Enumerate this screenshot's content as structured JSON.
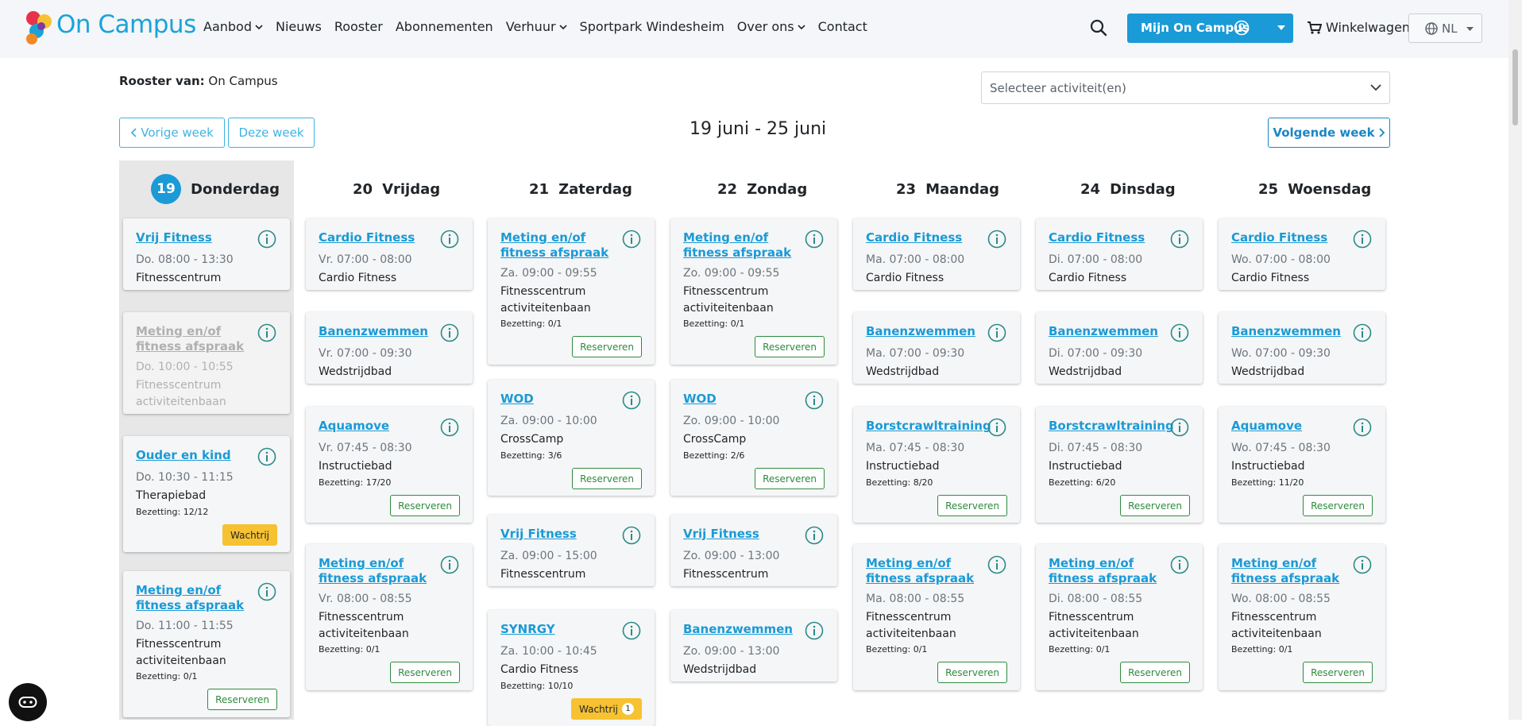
{
  "header": {
    "logo_text": "On Campus",
    "nav": [
      {
        "label": "Aanbod",
        "dropdown": true
      },
      {
        "label": "Nieuws",
        "dropdown": false
      },
      {
        "label": "Rooster",
        "dropdown": false
      },
      {
        "label": "Abonnementen",
        "dropdown": false
      },
      {
        "label": "Verhuur",
        "dropdown": true
      },
      {
        "label": "Sportpark Windesheim",
        "dropdown": false
      },
      {
        "label": "Over ons",
        "dropdown": true
      },
      {
        "label": "Contact",
        "dropdown": false
      }
    ],
    "account_button": "Mijn On Campus",
    "cart_label": "Winkelwagen",
    "language": "NL",
    "icons": [
      "search-icon",
      "user-circle-icon",
      "cart-icon",
      "globe-icon",
      "chat-icon"
    ],
    "accent_color": "#1a9ad6"
  },
  "schedule": {
    "rooster_prefix": "Rooster van:",
    "rooster_name": "On Campus",
    "activity_placeholder": "Selecteer activiteit(en)",
    "prev_week": "Vorige week",
    "this_week": "Deze week",
    "next_week": "Volgende week",
    "week_title": "19 juni - 25 juni"
  },
  "days": [
    {
      "num": "19",
      "name": "Donderdag",
      "today": true,
      "cards": [
        {
          "title": "Vrij Fitness",
          "time": "Do. 08:00 - 13:30",
          "location": "Fitnesscentrum"
        },
        {
          "title": "Meting en/of fitness afspraak",
          "time": "Do. 10:00 - 10:55",
          "location": "Fitnesscentrum activiteitenbaan",
          "faded": true
        },
        {
          "title": "Ouder en kind",
          "time": "Do. 10:30 - 11:15",
          "location": "Therapiebad",
          "occupancy": "Bezetting: 12/12",
          "button": "Wachtrij"
        },
        {
          "title": "Meting en/of fitness afspraak",
          "time": "Do. 11:00 - 11:55",
          "location": "Fitnesscentrum activiteitenbaan",
          "occupancy": "Bezetting: 0/1",
          "button": "Reserveren"
        }
      ]
    },
    {
      "num": "20",
      "name": "Vrijdag",
      "cards": [
        {
          "title": "Cardio Fitness",
          "time": "Vr. 07:00 - 08:00",
          "location": "Cardio Fitness"
        },
        {
          "title": "Banenzwemmen",
          "time": "Vr. 07:00 - 09:30",
          "location": "Wedstrijdbad"
        },
        {
          "title": "Aquamove",
          "time": "Vr. 07:45 - 08:30",
          "location": "Instructiebad",
          "occupancy": "Bezetting: 17/20",
          "button": "Reserveren"
        },
        {
          "title": "Meting en/of fitness afspraak",
          "time": "Vr. 08:00 - 08:55",
          "location": "Fitnesscentrum activiteitenbaan",
          "occupancy": "Bezetting: 0/1",
          "button": "Reserveren"
        }
      ]
    },
    {
      "num": "21",
      "name": "Zaterdag",
      "cards": [
        {
          "title": "Meting en/of fitness afspraak",
          "time": "Za. 09:00 - 09:55",
          "location": "Fitnesscentrum activiteitenbaan",
          "occupancy": "Bezetting: 0/1",
          "button": "Reserveren"
        },
        {
          "title": "WOD",
          "time": "Za. 09:00 - 10:00",
          "location": "CrossCamp",
          "occupancy": "Bezetting: 3/6",
          "button": "Reserveren"
        },
        {
          "title": "Vrij Fitness",
          "time": "Za. 09:00 - 15:00",
          "location": "Fitnesscentrum"
        },
        {
          "title": "SYNRGY",
          "time": "Za. 10:00 - 10:45",
          "location": "Cardio Fitness",
          "occupancy": "Bezetting: 10/10",
          "button": "Wachtrij",
          "badge": "1"
        }
      ]
    },
    {
      "num": "22",
      "name": "Zondag",
      "cards": [
        {
          "title": "Meting en/of fitness afspraak",
          "time": "Zo. 09:00 - 09:55",
          "location": "Fitnesscentrum activiteitenbaan",
          "occupancy": "Bezetting: 0/1",
          "button": "Reserveren"
        },
        {
          "title": "WOD",
          "time": "Zo. 09:00 - 10:00",
          "location": "CrossCamp",
          "occupancy": "Bezetting: 2/6",
          "button": "Reserveren"
        },
        {
          "title": "Vrij Fitness",
          "time": "Zo. 09:00 - 13:00",
          "location": "Fitnesscentrum"
        },
        {
          "title": "Banenzwemmen",
          "time": "Zo. 09:00 - 13:00",
          "location": "Wedstrijdbad"
        }
      ]
    },
    {
      "num": "23",
      "name": "Maandag",
      "cards": [
        {
          "title": "Cardio Fitness",
          "time": "Ma. 07:00 - 08:00",
          "location": "Cardio Fitness"
        },
        {
          "title": "Banenzwemmen",
          "time": "Ma. 07:00 - 09:30",
          "location": "Wedstrijdbad"
        },
        {
          "title": "Borstcrawltraining",
          "time": "Ma. 07:45 - 08:30",
          "location": "Instructiebad",
          "occupancy": "Bezetting: 8/20",
          "button": "Reserveren"
        },
        {
          "title": "Meting en/of fitness afspraak",
          "time": "Ma. 08:00 - 08:55",
          "location": "Fitnesscentrum activiteitenbaan",
          "occupancy": "Bezetting: 0/1",
          "button": "Reserveren"
        }
      ]
    },
    {
      "num": "24",
      "name": "Dinsdag",
      "cards": [
        {
          "title": "Cardio Fitness",
          "time": "Di. 07:00 - 08:00",
          "location": "Cardio Fitness"
        },
        {
          "title": "Banenzwemmen",
          "time": "Di. 07:00 - 09:30",
          "location": "Wedstrijdbad"
        },
        {
          "title": "Borstcrawltraining",
          "time": "Di. 07:45 - 08:30",
          "location": "Instructiebad",
          "occupancy": "Bezetting: 6/20",
          "button": "Reserveren"
        },
        {
          "title": "Meting en/of fitness afspraak",
          "time": "Di. 08:00 - 08:55",
          "location": "Fitnesscentrum activiteitenbaan",
          "occupancy": "Bezetting: 0/1",
          "button": "Reserveren"
        }
      ]
    },
    {
      "num": "25",
      "name": "Woensdag",
      "cards": [
        {
          "title": "Cardio Fitness",
          "time": "Wo. 07:00 - 08:00",
          "location": "Cardio Fitness"
        },
        {
          "title": "Banenzwemmen",
          "time": "Wo. 07:00 - 09:30",
          "location": "Wedstrijdbad"
        },
        {
          "title": "Aquamove",
          "time": "Wo. 07:45 - 08:30",
          "location": "Instructiebad",
          "occupancy": "Bezetting: 11/20",
          "button": "Reserveren"
        },
        {
          "title": "Meting en/of fitness afspraak",
          "time": "Wo. 08:00 - 08:55",
          "location": "Fitnesscentrum activiteitenbaan",
          "occupancy": "Bezetting: 0/1",
          "button": "Reserveren"
        }
      ]
    }
  ]
}
